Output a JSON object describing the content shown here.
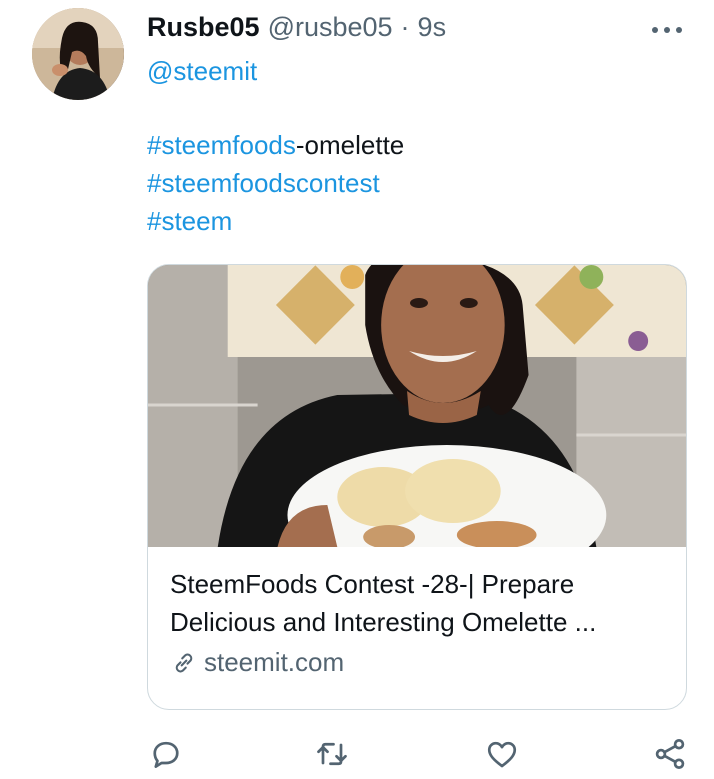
{
  "tweet": {
    "display_name": "Rusbe05",
    "handle": "@rusbe05",
    "separator": "·",
    "time": "9s",
    "mention": "@steemit",
    "tags": [
      {
        "link": "#steemfoods",
        "suffix": "-omelette"
      },
      {
        "link": "#steemfoodscontest",
        "suffix": ""
      },
      {
        "link": "#steem",
        "suffix": ""
      }
    ]
  },
  "card": {
    "title_line1": "SteemFoods Contest -28-| Prepare",
    "title_line2": "Delicious and Interesting Omelette ...",
    "domain": "steemit.com"
  },
  "icons": {
    "more": "more-horizontal-icon",
    "reply": "reply-icon",
    "retweet": "retweet-icon",
    "like": "heart-icon",
    "share": "share-icon",
    "link": "link-icon"
  },
  "colors": {
    "link": "#1b95e0",
    "text": "#0f1419",
    "muted": "#536471",
    "border": "#cfd9de"
  }
}
